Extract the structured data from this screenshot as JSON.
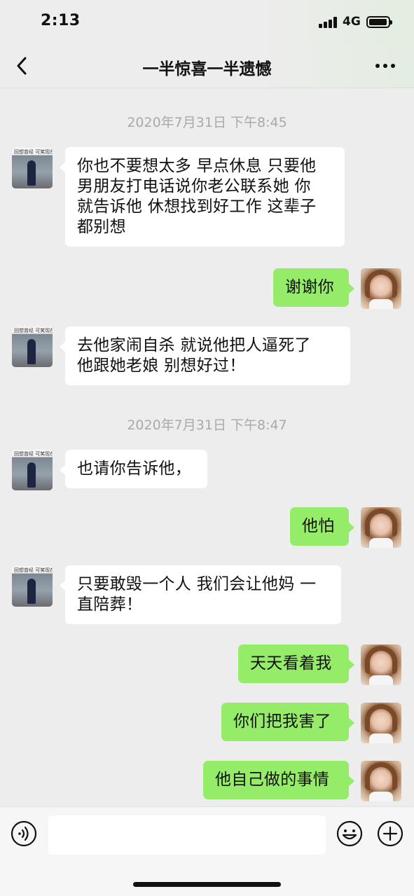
{
  "status_bar": {
    "time": "2:13",
    "network": "4G",
    "icons": [
      "signal-icon",
      "battery-icon"
    ]
  },
  "header": {
    "title": "一半惊喜一半遗憾",
    "back_icon": "chevron-left-icon",
    "more_icon": "more-icon"
  },
  "chat": {
    "timestamps": [
      "2020年7月31日 下午8:45",
      "2020年7月31日 下午8:47"
    ],
    "other_avatar_caption": "回想曾经  可笑现在",
    "messages": [
      {
        "side": "left",
        "lines": [
          "你也不要想太多 早点休息  只要他",
          "男朋友打电话说你老公联系她  你",
          "就告诉他 休想找到好工作 这辈子",
          "都别想"
        ]
      },
      {
        "side": "right",
        "lines": [
          "谢谢你"
        ]
      },
      {
        "side": "left",
        "lines": [
          "去他家闹自杀   就说他把人逼死了",
          " 他跟她老娘 别想好过！"
        ]
      },
      {
        "side": "left",
        "lines": [
          "也请你告诉他，"
        ]
      },
      {
        "side": "right",
        "lines": [
          "他怕"
        ]
      },
      {
        "side": "left",
        "lines": [
          "只要敢毁一个人 我们会让他妈 一",
          "直陪葬！"
        ]
      },
      {
        "side": "right",
        "lines": [
          "天天看着我"
        ]
      },
      {
        "side": "right",
        "lines": [
          "你们把我害了"
        ]
      },
      {
        "side": "right",
        "lines": [
          "他自己做的事情"
        ]
      }
    ]
  },
  "input_bar": {
    "voice_icon": "voice-icon",
    "emoji_icon": "emoji-icon",
    "add_icon": "plus-circle-icon",
    "input_value": ""
  },
  "colors": {
    "background": "#ededed",
    "sent_bubble": "#95ec69",
    "received_bubble": "#ffffff",
    "timestamp": "#a9a9a9"
  }
}
